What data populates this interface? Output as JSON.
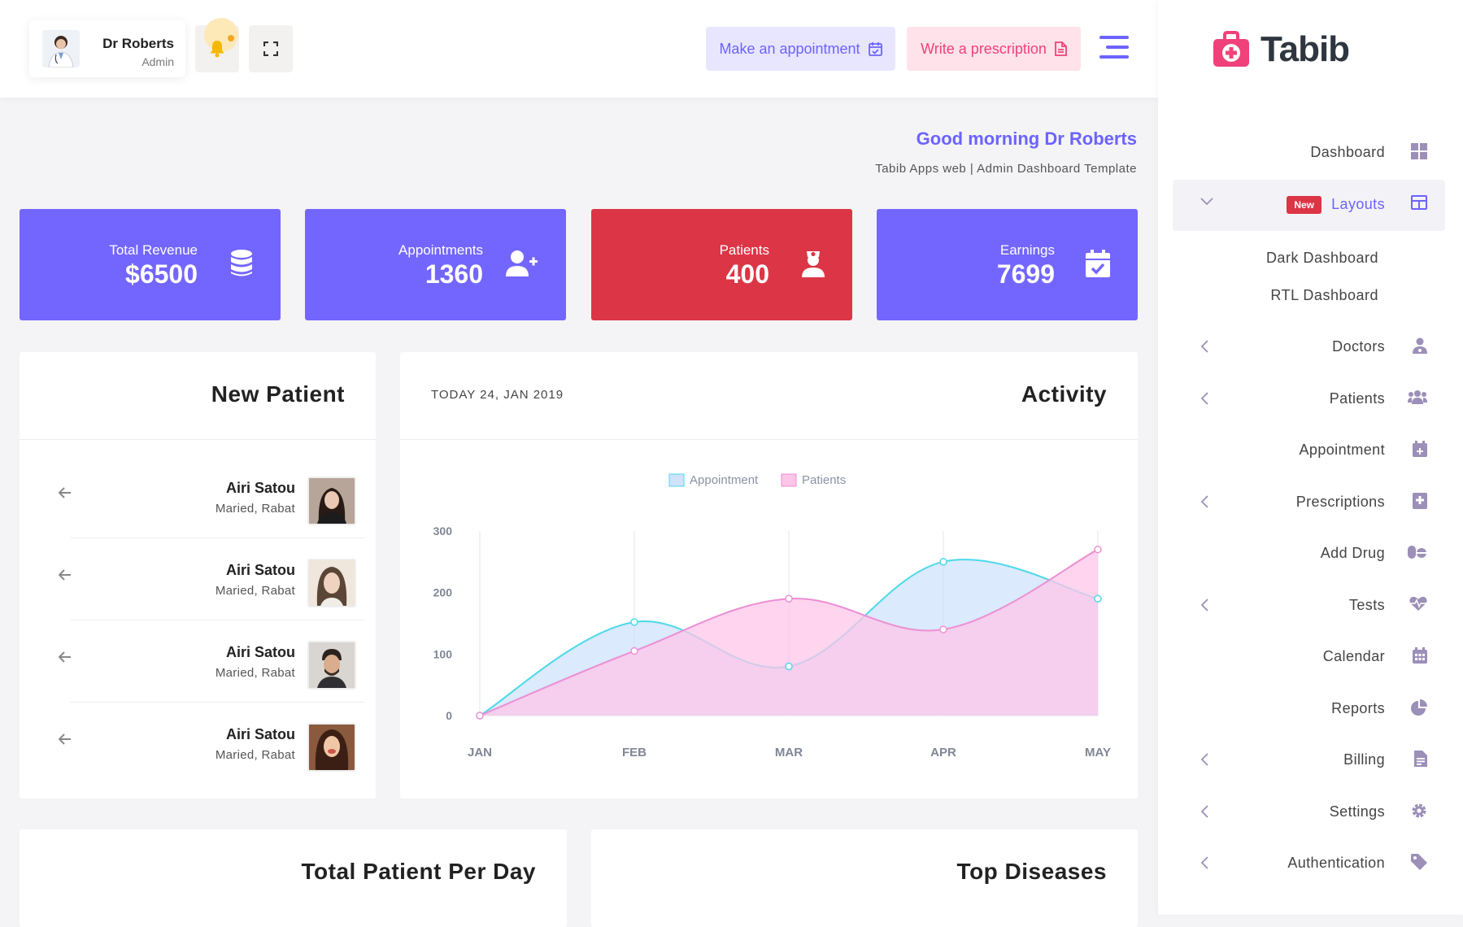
{
  "header": {
    "user_name": "Dr Roberts",
    "user_role": "Admin",
    "appointment_button": "Make an appointment",
    "prescription_button": "Write a prescription"
  },
  "greeting": {
    "title": "Good morning Dr Roberts",
    "subtitle": "Tabib Apps web | Admin Dashboard Template"
  },
  "stats": [
    {
      "label": "Total Revenue",
      "value": "$6500",
      "icon": "database-icon",
      "color": "#7366ff"
    },
    {
      "label": "Appointments",
      "value": "1360",
      "icon": "user-plus-icon",
      "color": "#7366ff"
    },
    {
      "label": "Patients",
      "value": "400",
      "icon": "nurse-icon",
      "color": "#dc3545"
    },
    {
      "label": "Earnings",
      "value": "7699",
      "icon": "calendar-check-icon",
      "color": "#7366ff"
    }
  ],
  "new_patient": {
    "title": "New Patient",
    "items": [
      {
        "name": "Airi Satou",
        "location": "Maried, Rabat"
      },
      {
        "name": "Airi Satou",
        "location": "Maried, Rabat"
      },
      {
        "name": "Airi Satou",
        "location": "Maried, Rabat"
      },
      {
        "name": "Airi Satou",
        "location": "Maried, Rabat"
      }
    ]
  },
  "activity": {
    "title": "Activity",
    "date": "TODAY 24, JAN 2019"
  },
  "bottom_cards": {
    "left_title": "Total Patient Per Day",
    "right_title": "Top Diseases"
  },
  "chart_data": {
    "type": "area",
    "categories": [
      "JAN",
      "FEB",
      "MAR",
      "APR",
      "MAY"
    ],
    "ylim": [
      0,
      300
    ],
    "yticks": [
      0,
      100,
      200,
      300
    ],
    "legend_position": "top-center",
    "series": [
      {
        "name": "Appointment",
        "values": [
          0,
          152,
          80,
          250,
          190
        ],
        "color": "#4dd9ea",
        "fill": "#cfe3fb"
      },
      {
        "name": "Patients",
        "values": [
          0,
          105,
          190,
          140,
          270
        ],
        "color": "#ec8fd4",
        "fill": "#fdc5e8"
      }
    ]
  },
  "sidebar": {
    "brand": "Tabib",
    "new_badge": "New",
    "items": [
      {
        "label": "Dashboard",
        "icon": "grid-icon",
        "chevron": false
      },
      {
        "label": "Layouts",
        "icon": "layout-icon",
        "chevron": true,
        "active": true
      },
      {
        "label": "Doctors",
        "icon": "doctor-icon",
        "chevron": true
      },
      {
        "label": "Patients",
        "icon": "users-icon",
        "chevron": true
      },
      {
        "label": "Appointment",
        "icon": "calendar-plus-icon",
        "chevron": false
      },
      {
        "label": "Prescriptions",
        "icon": "medical-book-icon",
        "chevron": true
      },
      {
        "label": "Add Drug",
        "icon": "pills-icon",
        "chevron": false
      },
      {
        "label": "Tests",
        "icon": "heartbeat-icon",
        "chevron": true
      },
      {
        "label": "Calendar",
        "icon": "calendar-icon",
        "chevron": false
      },
      {
        "label": "Reports",
        "icon": "pie-chart-icon",
        "chevron": false
      },
      {
        "label": "Billing",
        "icon": "file-invoice-icon",
        "chevron": true
      },
      {
        "label": "Settings",
        "icon": "gear-icon",
        "chevron": true
      },
      {
        "label": "Authentication",
        "icon": "tag-icon",
        "chevron": true
      }
    ],
    "subitems": [
      "Dark Dashboard",
      "RTL Dashboard"
    ]
  }
}
